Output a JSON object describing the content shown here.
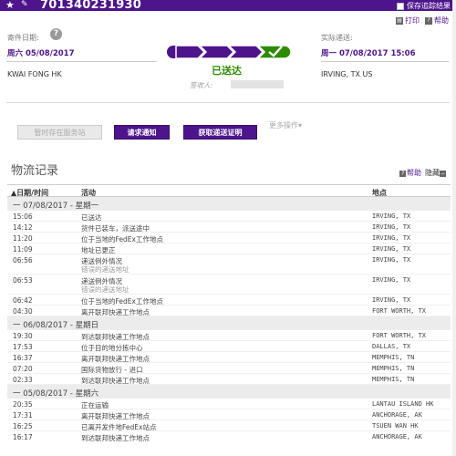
{
  "header": {
    "tracking_number": "701340231930",
    "save_label": "保存追踪结果"
  },
  "actions_top": {
    "print": "打印",
    "help": "帮助"
  },
  "summary": {
    "ship_date_label": "寄件日期:",
    "ship_date": "周六 05/08/2017",
    "actual_delivery_label": "实际递送:",
    "actual_delivery": "周一 07/08/2017 15:06",
    "origin": "KWAI FONG HK",
    "destination": "IRVING, TX US",
    "status": "已送达",
    "signee_label": "签收人:"
  },
  "buttons": {
    "hold": "暂时存在服务站",
    "notify": "请求通知",
    "proof": "获取递送证明",
    "more": "更多操作▾"
  },
  "history": {
    "title": "物流记录",
    "help": "帮助",
    "hide": "隐藏",
    "col_date": "▲日期/时间",
    "col_activity": "活动",
    "col_location": "地点",
    "groups": [
      {
        "label": "一   07/08/2017 - 星期一",
        "rows": [
          {
            "time": "15:06",
            "activity": "已送达",
            "sub": "",
            "location": "IRVING, TX"
          },
          {
            "time": "14:12",
            "activity": "货件已装车，派送途中",
            "sub": "",
            "location": "IRVING, TX"
          },
          {
            "time": "11:20",
            "activity": "位于当地的FedEx工作地点",
            "sub": "",
            "location": "IRVING, TX"
          },
          {
            "time": "11:09",
            "activity": "地址已更正",
            "sub": "",
            "location": "IRVING, TX"
          },
          {
            "time": "06:56",
            "activity": "递送例外情况",
            "sub": "错误的递送地址",
            "location": "IRVING, TX"
          },
          {
            "time": "06:53",
            "activity": "递送例外情况",
            "sub": "错误的递送地址",
            "location": "IRVING, TX"
          },
          {
            "time": "06:42",
            "activity": "位于当地的FedEx工作地点",
            "sub": "",
            "location": "IRVING, TX"
          },
          {
            "time": "04:30",
            "activity": "离开联邦快递工作地点",
            "sub": "",
            "location": "FORT WORTH, TX"
          }
        ]
      },
      {
        "label": "一   06/08/2017 - 星期日",
        "rows": [
          {
            "time": "19:30",
            "activity": "到达联邦快递工作地点",
            "sub": "",
            "location": "FORT WORTH, TX"
          },
          {
            "time": "17:53",
            "activity": "位于目的地分拣中心",
            "sub": "",
            "location": "DALLAS, TX"
          },
          {
            "time": "16:37",
            "activity": "离开联邦快递工作地点",
            "sub": "",
            "location": "MEMPHIS, TN"
          },
          {
            "time": "07:20",
            "activity": "国际货物放行 - 进口",
            "sub": "",
            "location": "MEMPHIS, TN"
          },
          {
            "time": "02:33",
            "activity": "到达联邦快递工作地点",
            "sub": "",
            "location": "MEMPHIS, TN"
          }
        ]
      },
      {
        "label": "一   05/08/2017 - 星期六",
        "rows": [
          {
            "time": "20:35",
            "activity": "正在运输",
            "sub": "",
            "location": "LANTAU ISLAND HK"
          },
          {
            "time": "17:31",
            "activity": "离开联邦快递工作地点",
            "sub": "",
            "location": "ANCHORAGE, AK"
          },
          {
            "time": "16:25",
            "activity": "已离开发件地FedEx站点",
            "sub": "",
            "location": "TSUEN WAN HK"
          },
          {
            "time": "16:17",
            "activity": "到达联邦快递工作地点",
            "sub": "",
            "location": "ANCHORAGE, AK"
          }
        ]
      }
    ]
  },
  "colors": {
    "brand_purple": "#4d148c",
    "delivered_green": "#2e8b00"
  }
}
